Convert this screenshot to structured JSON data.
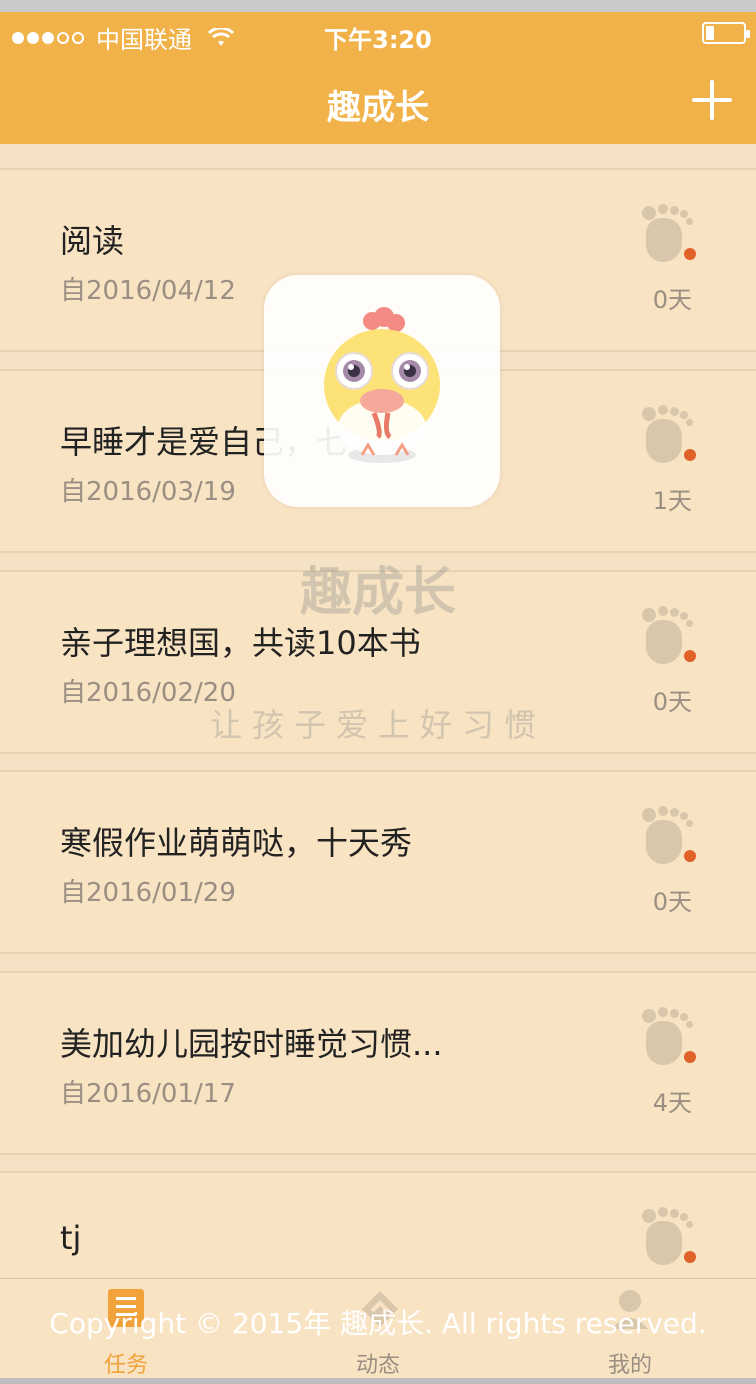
{
  "status_bar": {
    "carrier": "中国联通",
    "time": "下午3:20"
  },
  "nav": {
    "title": "趣成长"
  },
  "tasks": [
    {
      "title": "阅读",
      "date": "自2016/04/12",
      "days": "0天"
    },
    {
      "title": "早睡才是爱自己，七天秀",
      "date": "自2016/03/19",
      "days": "1天"
    },
    {
      "title": "亲子理想国，共读10本书",
      "date": "自2016/02/20",
      "days": "0天"
    },
    {
      "title": "寒假作业萌萌哒，十天秀",
      "date": "自2016/01/29",
      "days": "0天"
    },
    {
      "title": "美加幼儿园按时睡觉习惯...",
      "date": "自2016/01/17",
      "days": "4天"
    },
    {
      "title": "tj",
      "date": "",
      "days": ""
    }
  ],
  "splash": {
    "app_name": "趣成长",
    "slogan": "让孩子爱上好习惯",
    "copyright": "Copyright © 2015年 趣成长. All rights reserved."
  },
  "tabs": [
    {
      "label": "任务"
    },
    {
      "label": "动态"
    },
    {
      "label": "我的"
    }
  ],
  "colors": {
    "brand": "#f1b24a",
    "card": "#f8e3c3",
    "badge": "#e0622a"
  }
}
